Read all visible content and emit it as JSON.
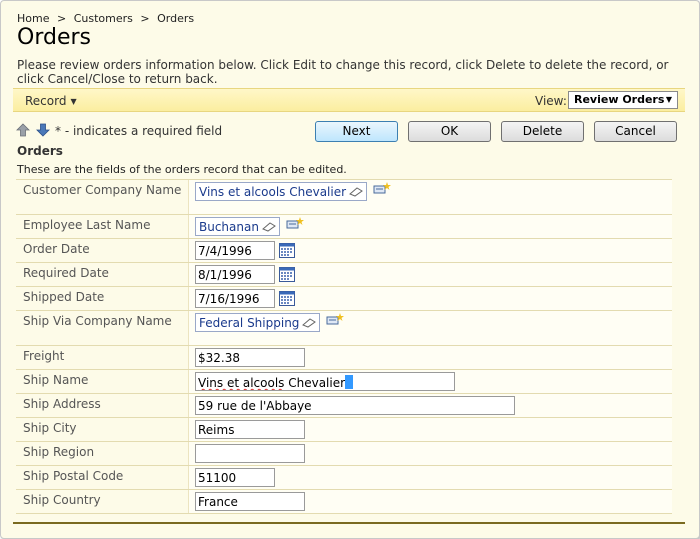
{
  "breadcrumb": [
    "Home",
    ">",
    "Customers",
    ">",
    "Orders"
  ],
  "page_title": "Orders",
  "description": "Please review orders information below. Click Edit to change this record, click Delete to delete the record, or click Cancel/Close to return back.",
  "action_bar": {
    "record_menu": "Record",
    "view_label": "View:",
    "view_value": "Review Orders"
  },
  "required_note": "* - indicates a required field",
  "buttons": {
    "next": "Next",
    "ok": "OK",
    "delete": "Delete",
    "cancel": "Cancel"
  },
  "section": {
    "title": "Orders",
    "description": "These are the fields of the orders record that can be edited."
  },
  "fields": {
    "customer_company_name": {
      "label": "Customer Company Name",
      "value": "Vins et alcools Chevalier"
    },
    "employee_last_name": {
      "label": "Employee Last Name",
      "value": "Buchanan"
    },
    "order_date": {
      "label": "Order Date",
      "value": "7/4/1996"
    },
    "required_date": {
      "label": "Required Date",
      "value": "8/1/1996"
    },
    "shipped_date": {
      "label": "Shipped Date",
      "value": "7/16/1996"
    },
    "ship_via_company_name": {
      "label": "Ship Via Company Name",
      "value": "Federal Shipping"
    },
    "freight": {
      "label": "Freight",
      "value": "$32.38"
    },
    "ship_name": {
      "label": "Ship Name",
      "value_part1": "Vins et alcools",
      "value_part2": " Chevalier"
    },
    "ship_address": {
      "label": "Ship Address",
      "value": "59 rue de l'Abbaye"
    },
    "ship_city": {
      "label": "Ship City",
      "value": "Reims"
    },
    "ship_region": {
      "label": "Ship Region",
      "value": ""
    },
    "ship_postal_code": {
      "label": "Ship Postal Code",
      "value": "51100"
    },
    "ship_country": {
      "label": "Ship Country",
      "value": "France"
    }
  },
  "colors": {
    "accent_bar": "#fbeea0",
    "background": "#fdfbe8",
    "lookup_text": "#1a3a8c",
    "primary_button": "#bee6fd"
  }
}
